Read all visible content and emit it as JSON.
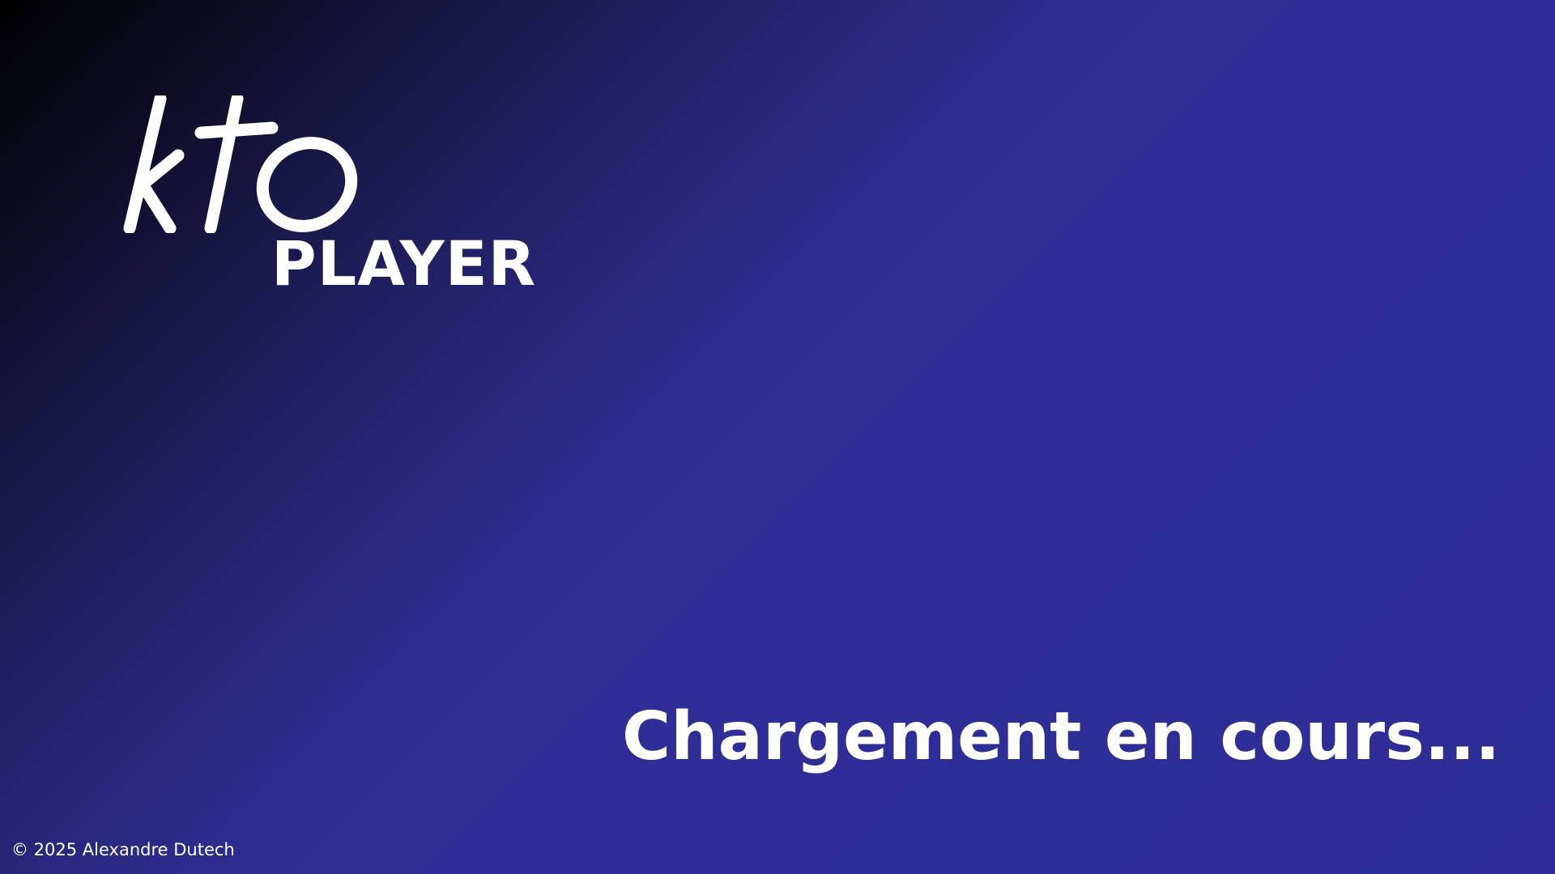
{
  "app": {
    "logo_name": "kto-logo",
    "logo_text": "kto",
    "product_label": "PLAYER"
  },
  "status": {
    "loading_text": "Chargement en cours..."
  },
  "footer": {
    "copyright": "© 2025 Alexandre Dutech"
  },
  "colors": {
    "background_start": "#000000",
    "background_mid": "#1a1a4e",
    "background_end": "#2f2f96",
    "text": "#ffffff"
  }
}
